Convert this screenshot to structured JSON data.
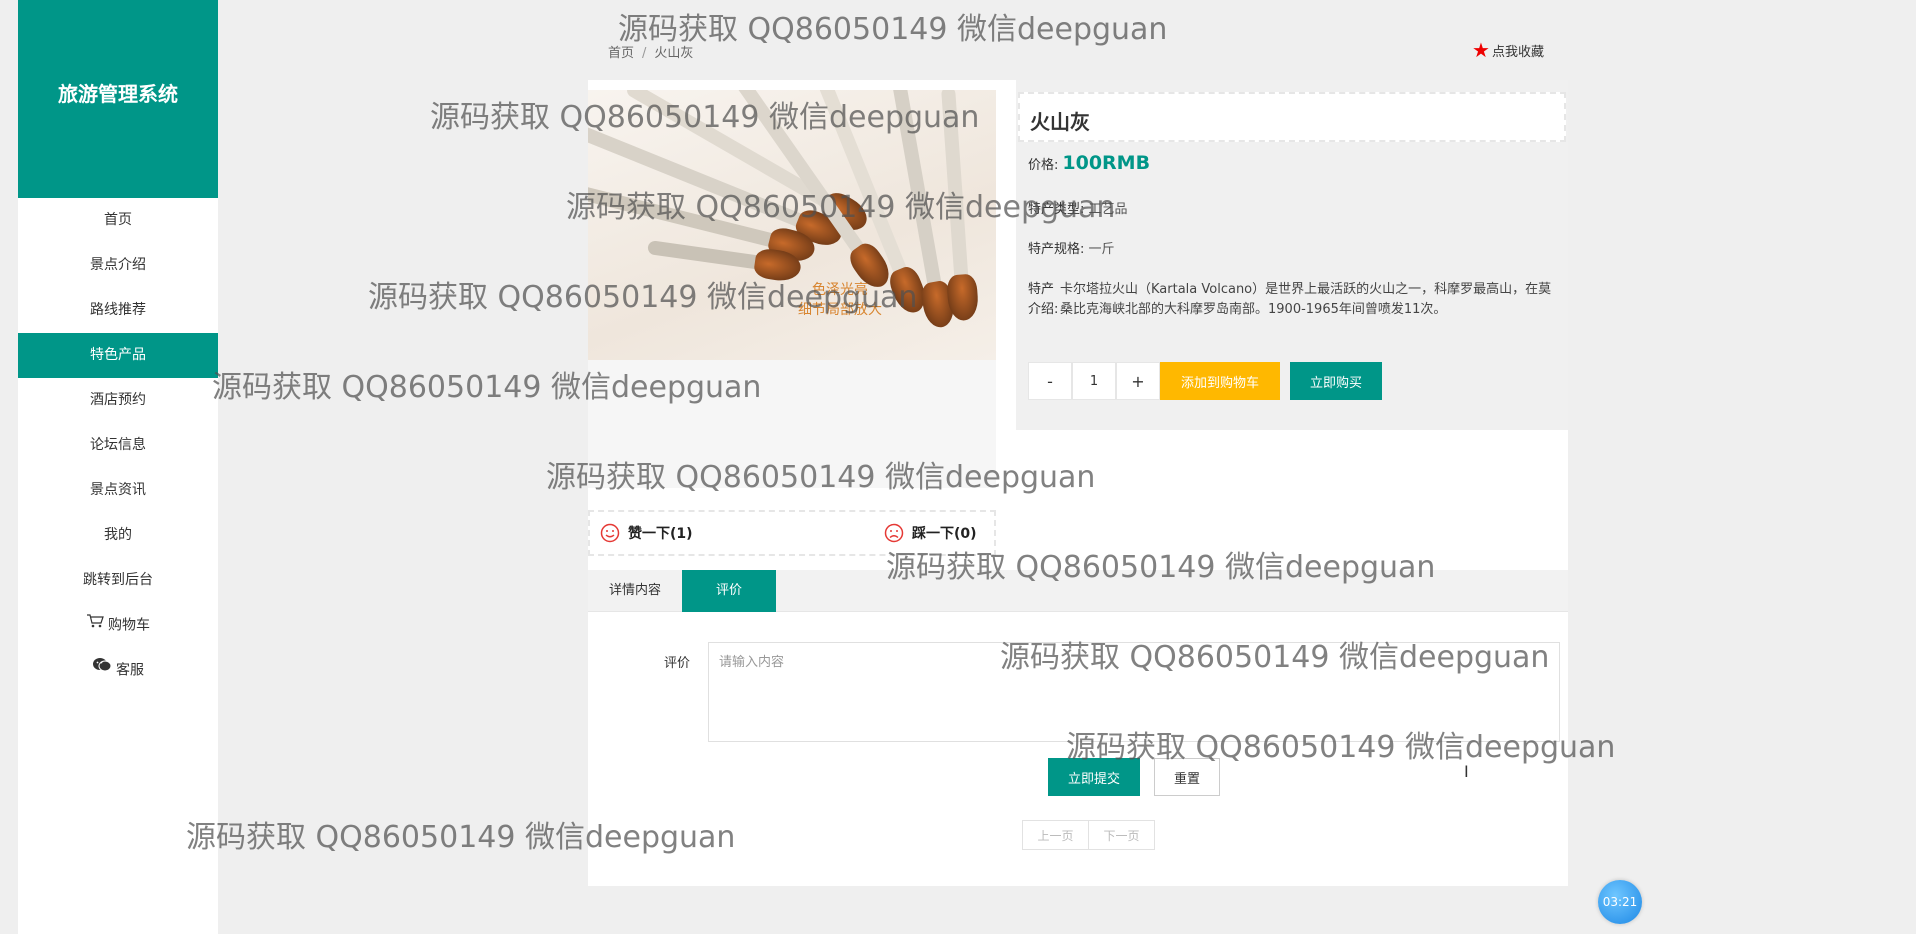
{
  "sidebar": {
    "brand": "旅游管理系统",
    "items": [
      {
        "label": "首页",
        "active": false
      },
      {
        "label": "景点介绍",
        "active": false
      },
      {
        "label": "路线推荐",
        "active": false
      },
      {
        "label": "特色产品",
        "active": true
      },
      {
        "label": "酒店预约",
        "active": false
      },
      {
        "label": "论坛信息",
        "active": false
      },
      {
        "label": "景点资讯",
        "active": false
      },
      {
        "label": "我的",
        "active": false
      },
      {
        "label": "跳转到后台",
        "active": false
      },
      {
        "label": "购物车",
        "active": false,
        "icon": "cart-icon"
      },
      {
        "label": "客服",
        "active": false,
        "icon": "chat-icon"
      }
    ]
  },
  "breadcrumb": {
    "home": "首页",
    "separator": "/",
    "current": "火山灰"
  },
  "favorite": {
    "label": "点我收藏",
    "icon": "star-icon"
  },
  "product": {
    "photo_text": [
      "色泽光亮",
      "细节局部放大"
    ],
    "name": "火山灰",
    "price_label": "价格:",
    "price": "100RMB",
    "type_label": "特产类型:",
    "type": "工艺品",
    "spec_label": "特产规格:",
    "spec": "一斤",
    "desc_label": "特产介绍:",
    "desc": "卡尔塔拉火山（Kartala Volcano）是世界上最活跃的火山之一，科摩罗最高山，在莫桑比克海峡北部的大科摩罗岛南部。1900-1965年间曾喷发11次。"
  },
  "quantity": {
    "minus": "-",
    "value": "1",
    "plus": "+"
  },
  "actions": {
    "add_to_cart": "添加到购物车",
    "buy_now": "立即购买"
  },
  "vote": {
    "up_label": "赞一下(1)",
    "down_label": "踩一下(0)"
  },
  "tabs": {
    "detail": "详情内容",
    "review": "评价"
  },
  "review_form": {
    "label": "评价",
    "placeholder": "请输入内容",
    "submit": "立即提交",
    "reset": "重置"
  },
  "pager": {
    "prev": "上一页",
    "next": "下一页"
  },
  "timer": "03:21",
  "watermark": "源码获取 QQ86050149 微信deepguan",
  "colors": {
    "accent": "#009688",
    "warning": "#ffb800",
    "star": "#e00000"
  }
}
